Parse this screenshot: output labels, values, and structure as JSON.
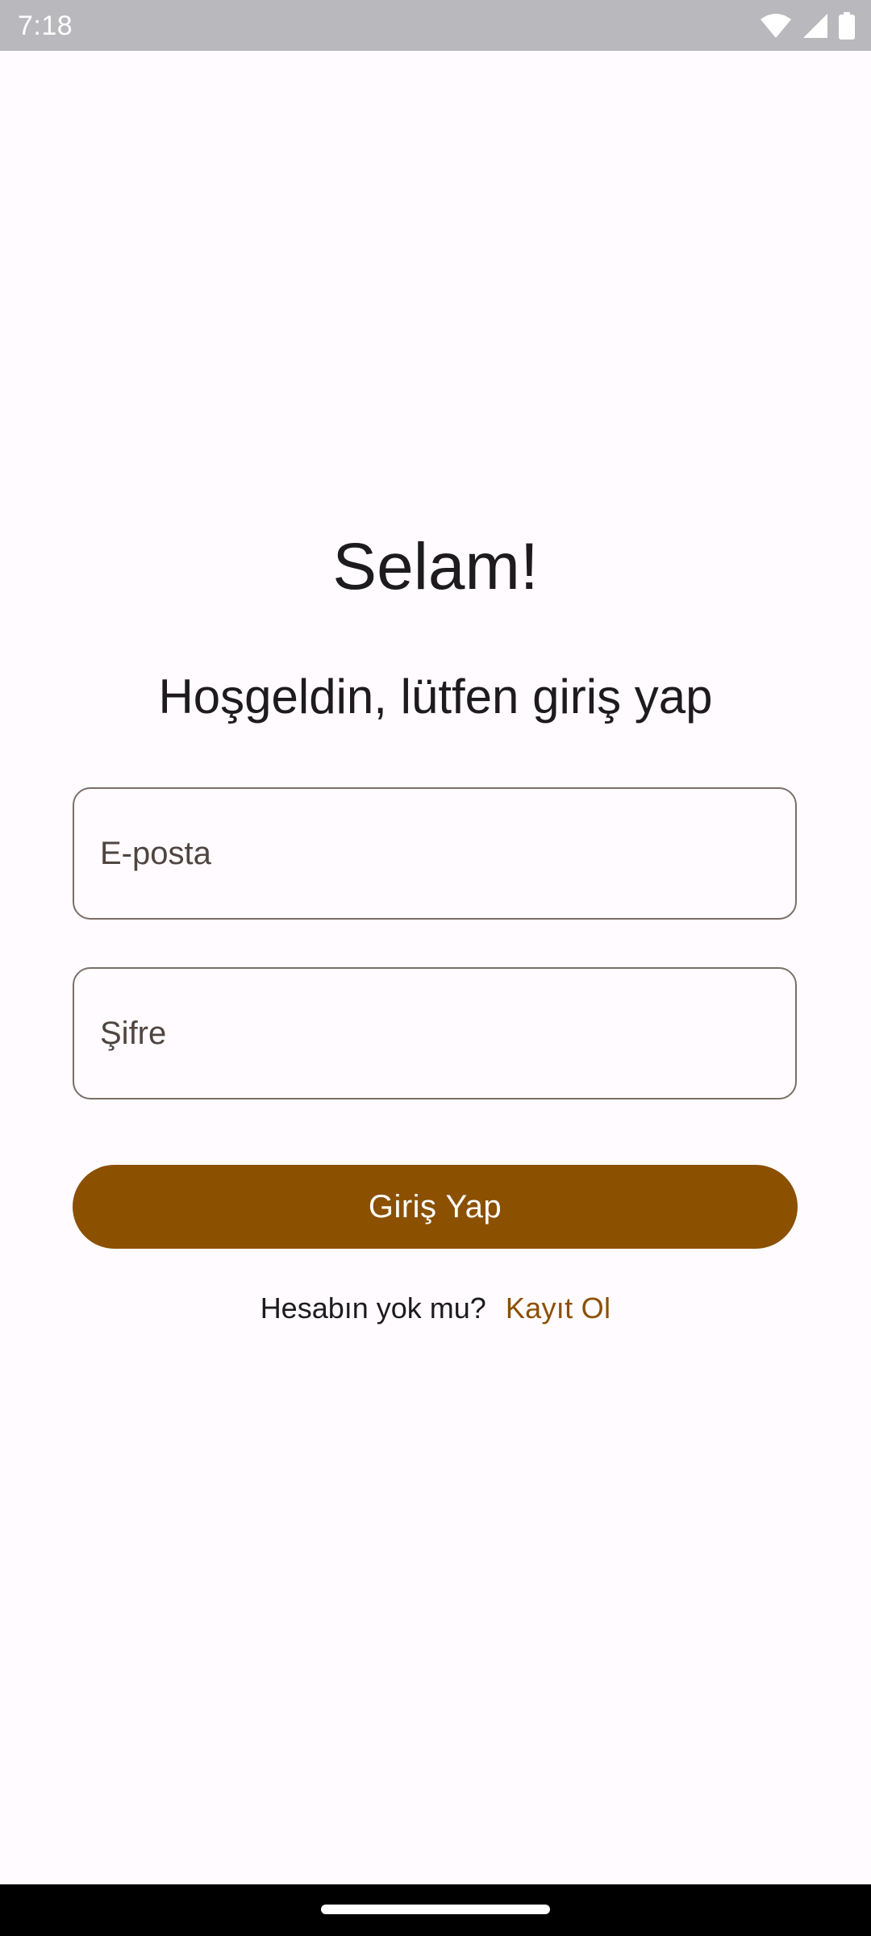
{
  "status_bar": {
    "time": "7:18",
    "icons": [
      "wifi-icon",
      "cell-signal-icon",
      "battery-icon"
    ]
  },
  "login": {
    "title": "Selam!",
    "subtitle": "Hoşgeldin, lütfen giriş yap",
    "email_placeholder": "E-posta",
    "email_value": "",
    "password_placeholder": "Şifre",
    "password_value": "",
    "submit_label": "Giriş Yap",
    "signup_prompt": "Hesabın yok mu?",
    "signup_link": "Kayıt Ol"
  },
  "colors": {
    "background": "#fffbfe",
    "accent": "#8b5000",
    "field_border": "#7a6f68",
    "status_bar": "#b9b8bc",
    "nav_bar": "#000000"
  }
}
